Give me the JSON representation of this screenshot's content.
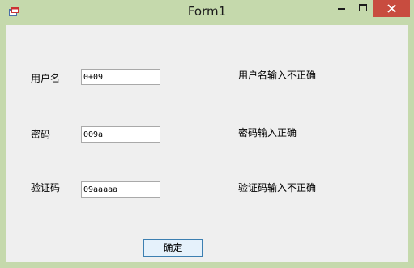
{
  "window": {
    "title": "Form1"
  },
  "form": {
    "username_label": "用户名",
    "username_value": "0+09",
    "username_status": "用户名输入不正确",
    "password_label": "密码",
    "password_value": "009a",
    "password_status": "密码输入正确",
    "captcha_label": "验证码",
    "captcha_value": "09aaaaa",
    "captcha_status": "验证码输入不正确",
    "ok_label": "确定"
  }
}
